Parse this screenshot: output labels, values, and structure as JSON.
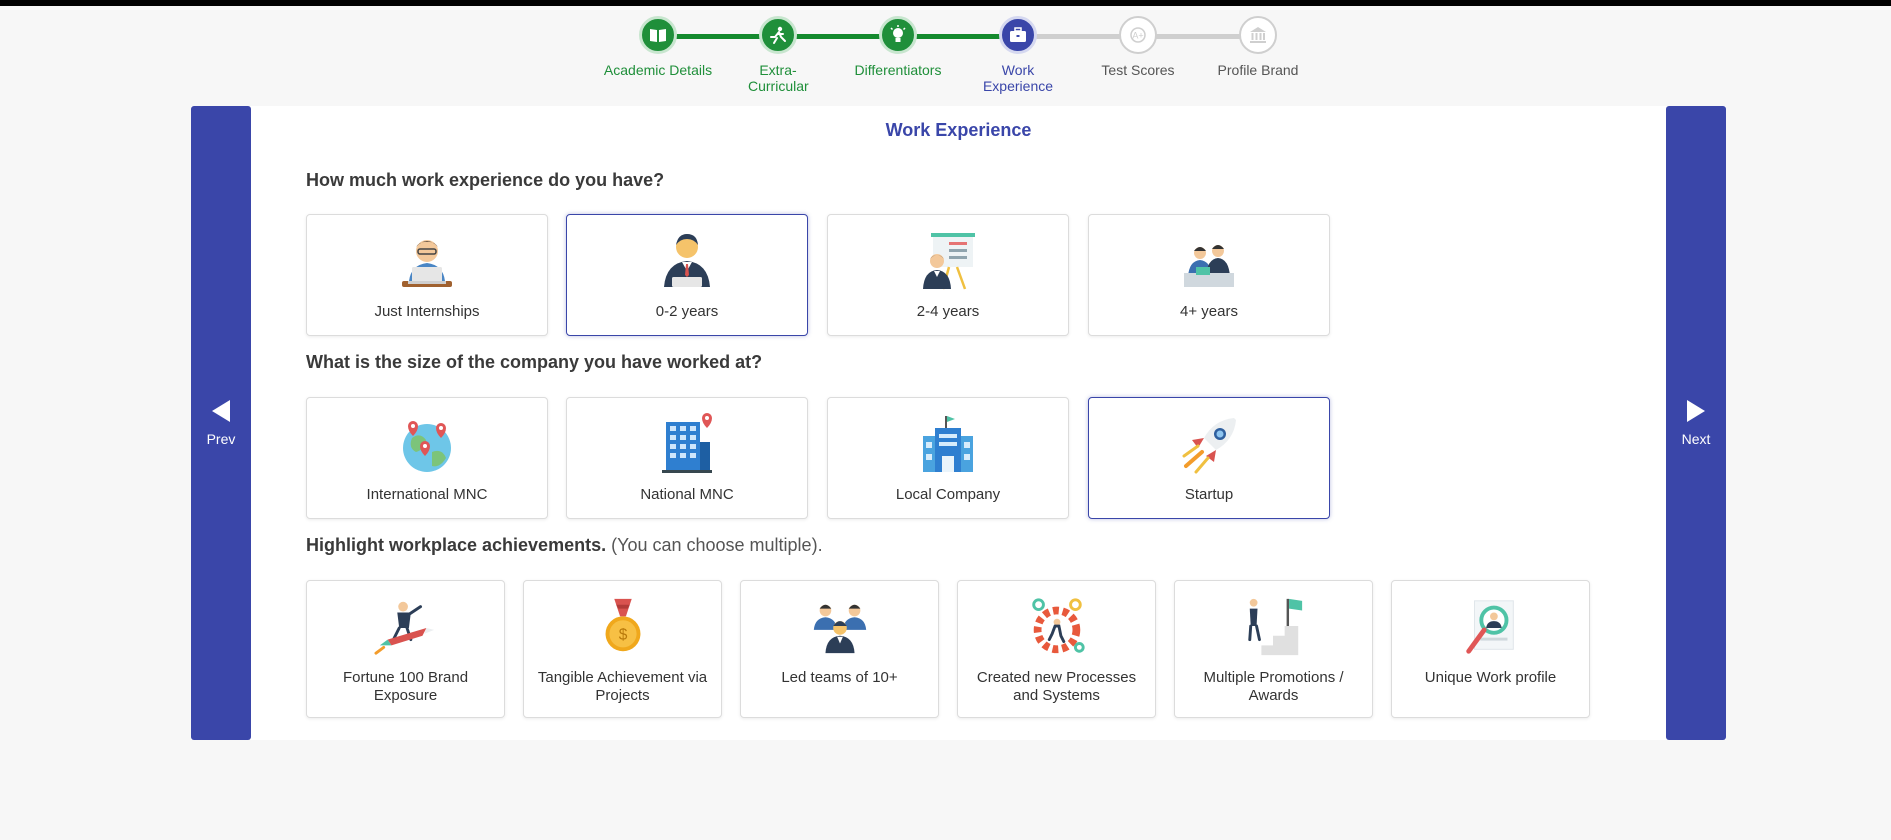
{
  "stepper": {
    "steps": [
      {
        "label": "Academic Details",
        "state": "done",
        "icon": "book-icon"
      },
      {
        "label": "Extra-Curricular",
        "state": "done",
        "icon": "runner-icon"
      },
      {
        "label": "Differentiators",
        "state": "done",
        "icon": "lightbulb-icon"
      },
      {
        "label": "Work Experience",
        "state": "current",
        "icon": "briefcase-icon"
      },
      {
        "label": "Test Scores",
        "state": "todo",
        "icon": "grade-icon"
      },
      {
        "label": "Profile Brand",
        "state": "todo",
        "icon": "institution-icon"
      }
    ]
  },
  "nav": {
    "prev_label": "Prev",
    "next_label": "Next"
  },
  "page": {
    "title": "Work Experience"
  },
  "q1": {
    "text": "How much work experience do you have?",
    "options": [
      {
        "label": "Just Internships",
        "selected": false,
        "icon": "intern-laptop-icon"
      },
      {
        "label": "0-2 years",
        "selected": true,
        "icon": "employee-icon"
      },
      {
        "label": "2-4 years",
        "selected": false,
        "icon": "presenter-icon"
      },
      {
        "label": "4+ years",
        "selected": false,
        "icon": "meeting-icon"
      }
    ]
  },
  "q2": {
    "text": "What is the size of the company you have worked at?",
    "options": [
      {
        "label": "International MNC",
        "selected": false,
        "icon": "globe-pins-icon"
      },
      {
        "label": "National MNC",
        "selected": false,
        "icon": "building-pin-icon"
      },
      {
        "label": "Local Company",
        "selected": false,
        "icon": "office-icon"
      },
      {
        "label": "Startup",
        "selected": true,
        "icon": "rocket-icon"
      }
    ]
  },
  "q3": {
    "text": "Highlight workplace achievements.",
    "note": "(You can choose multiple).",
    "options": [
      {
        "label": "Fortune 100 Brand Exposure",
        "icon": "rocket-man-icon"
      },
      {
        "label": "Tangible Achievement via Projects",
        "icon": "medal-icon"
      },
      {
        "label": "Led teams of 10+",
        "icon": "team-icon"
      },
      {
        "label": "Created new Processes and Systems",
        "icon": "gear-person-icon"
      },
      {
        "label": "Multiple Promotions / Awards",
        "icon": "stairs-flag-icon"
      },
      {
        "label": "Unique Work profile",
        "icon": "profile-search-icon"
      }
    ]
  },
  "colors": {
    "accent": "#3a46a9",
    "done": "#1f8f3a",
    "track_todo": "#cfcfcf"
  }
}
